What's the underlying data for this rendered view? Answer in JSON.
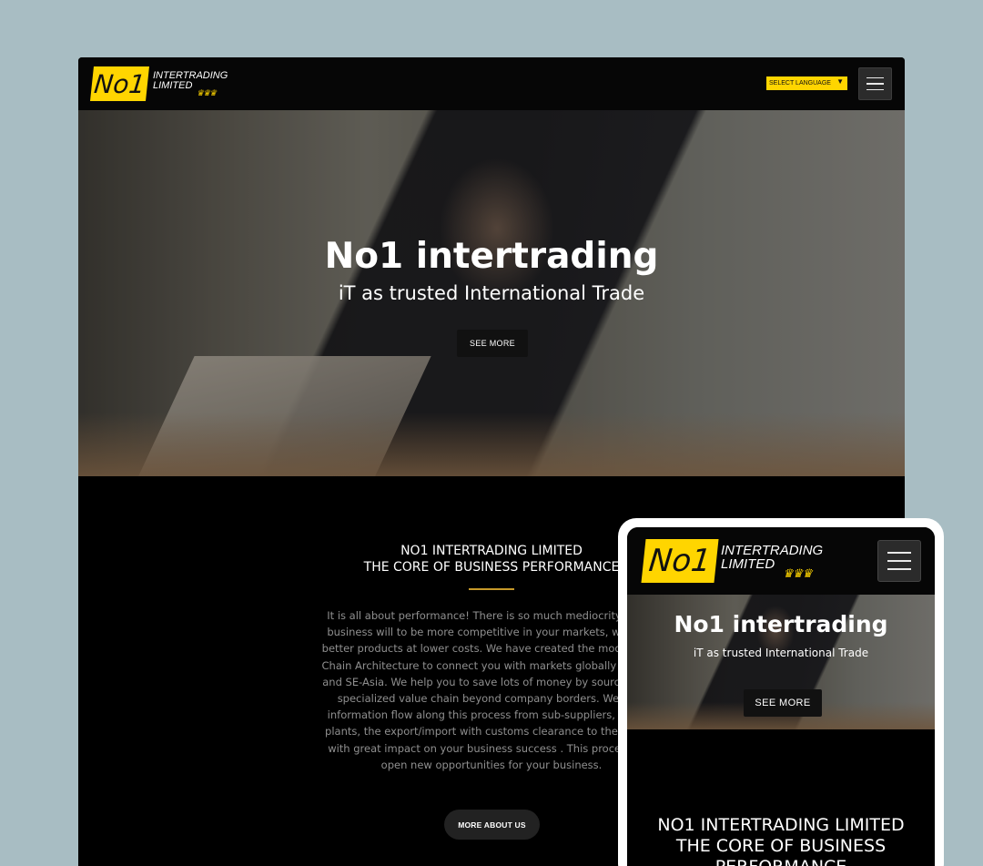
{
  "logo": {
    "mark": "No1",
    "line1": "INTERTRADING",
    "line2": "LIMITED",
    "crown": "♛♛♛"
  },
  "header": {
    "language_label": "SELECT LANGUAGE",
    "language_arrow": "▼"
  },
  "hero": {
    "title": "No1 intertrading",
    "subtitle": "iT as trusted International Trade",
    "cta_label": "SEE MORE"
  },
  "about": {
    "heading_line1": "NO1 INTERTRADING LIMITED",
    "heading_line2": "THE CORE OF BUSINESS PERFORMANCE",
    "paragraph_lines": [
      "It is all about performance! There is so much mediocrity out th",
      "business will to be more competitive in your markets, when yo",
      "better products at lower costs. We have created the model of Ad",
      "Chain Architecture to connect you with markets globally and esp",
      "and SE-Asia. We help you to save lots of money by sourcing thro",
      "specialized value chain beyond company borders. We man",
      "information flow along this process from sub-suppliers, the ma",
      "plants, the export/import with customs clearance to the Europe",
      "with great impact on your business success . This process orie",
      "open new opportunities for your business."
    ],
    "button_label": "MORE ABOUT US"
  },
  "mobile": {
    "hero_title": "No1 intertrading",
    "hero_subtitle": "iT as trusted International Trade",
    "cta_label": "SEE MORE",
    "heading_line1": "NO1 INTERTRADING LIMITED",
    "heading_line2": "THE CORE OF BUSINESS",
    "heading_line3": "PERFORMANCE"
  },
  "colors": {
    "brand_yellow": "#ffd500",
    "accent_gold": "#c79a2a",
    "background": "#a8bdc3"
  }
}
